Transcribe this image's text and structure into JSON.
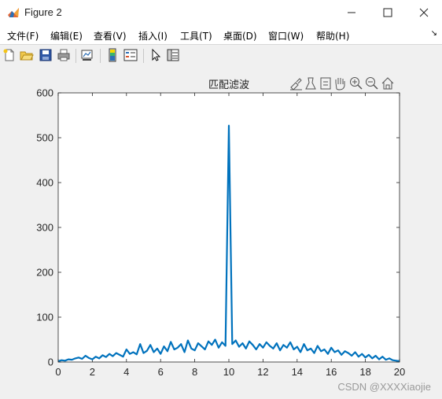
{
  "window": {
    "title": "Figure 2",
    "controls": [
      "minimize",
      "maximize",
      "close"
    ]
  },
  "menu": {
    "items": [
      {
        "label": "文件(F)"
      },
      {
        "label": "编辑(E)"
      },
      {
        "label": "查看(V)"
      },
      {
        "label": "插入(I)"
      },
      {
        "label": "工具(T)"
      },
      {
        "label": "桌面(D)"
      },
      {
        "label": "窗口(W)"
      },
      {
        "label": "帮助(H)"
      }
    ],
    "overflow_arrow": "↘"
  },
  "toolbar": {
    "icons": [
      "new-figure-icon",
      "open-file-icon",
      "save-icon",
      "print-icon",
      "link-plot-icon",
      "colorbar-icon",
      "legend-icon",
      "pointer-icon",
      "property-inspector-icon"
    ]
  },
  "axes_toolbar": {
    "icons": [
      "brush-icon",
      "data-tips-icon",
      "rotate-icon",
      "pan-icon",
      "zoom-in-icon",
      "zoom-out-icon",
      "home-icon"
    ]
  },
  "watermark": "CSDN @XXXXiaojie",
  "colors": {
    "line": "#0072bd",
    "axes_bg": "#ffffff",
    "figure_bg": "#f0f0f0"
  },
  "chart_data": {
    "type": "line",
    "title": "匹配滤波",
    "xlabel": "",
    "ylabel": "",
    "xlim": [
      0,
      20
    ],
    "ylim": [
      0,
      600
    ],
    "xticks": [
      0,
      2,
      4,
      6,
      8,
      10,
      12,
      14,
      16,
      18,
      20
    ],
    "yticks": [
      0,
      100,
      200,
      300,
      400,
      500,
      600
    ],
    "grid": false,
    "peak": {
      "x": 10,
      "y": 527
    },
    "noise_floor_max": 52,
    "series": [
      {
        "x": [
          0,
          0.2,
          0.4,
          0.6,
          0.8,
          1.0,
          1.2,
          1.4,
          1.6,
          1.8,
          2.0,
          2.2,
          2.4,
          2.6,
          2.8,
          3.0,
          3.2,
          3.4,
          3.6,
          3.8,
          4.0,
          4.2,
          4.4,
          4.6,
          4.8,
          5.0,
          5.2,
          5.4,
          5.6,
          5.8,
          6.0,
          6.2,
          6.4,
          6.6,
          6.8,
          7.0,
          7.2,
          7.4,
          7.6,
          7.8,
          8.0,
          8.2,
          8.4,
          8.6,
          8.8,
          9.0,
          9.2,
          9.4,
          9.6,
          9.8,
          10.0,
          10.2,
          10.4,
          10.6,
          10.8,
          11.0,
          11.2,
          11.4,
          11.6,
          11.8,
          12.0,
          12.2,
          12.4,
          12.6,
          12.8,
          13.0,
          13.2,
          13.4,
          13.6,
          13.8,
          14.0,
          14.2,
          14.4,
          14.6,
          14.8,
          15.0,
          15.2,
          15.4,
          15.6,
          15.8,
          16.0,
          16.2,
          16.4,
          16.6,
          16.8,
          17.0,
          17.2,
          17.4,
          17.6,
          17.8,
          18.0,
          18.2,
          18.4,
          18.6,
          18.8,
          19.0,
          19.2,
          19.4,
          19.6,
          19.8,
          20.0
        ],
        "y": [
          2,
          4,
          3,
          6,
          5,
          8,
          10,
          7,
          14,
          9,
          6,
          12,
          8,
          15,
          11,
          18,
          13,
          20,
          16,
          12,
          28,
          18,
          22,
          17,
          40,
          20,
          25,
          38,
          22,
          30,
          18,
          35,
          24,
          45,
          28,
          32,
          40,
          22,
          48,
          30,
          26,
          42,
          35,
          28,
          46,
          38,
          50,
          32,
          44,
          36,
          527,
          40,
          48,
          34,
          42,
          30,
          46,
          38,
          28,
          40,
          32,
          44,
          36,
          30,
          42,
          26,
          38,
          32,
          44,
          28,
          34,
          22,
          40,
          26,
          30,
          20,
          36,
          24,
          28,
          18,
          32,
          22,
          26,
          16,
          24,
          20,
          14,
          22,
          12,
          18,
          10,
          16,
          8,
          14,
          6,
          12,
          5,
          8,
          4,
          3,
          2
        ]
      }
    ]
  }
}
